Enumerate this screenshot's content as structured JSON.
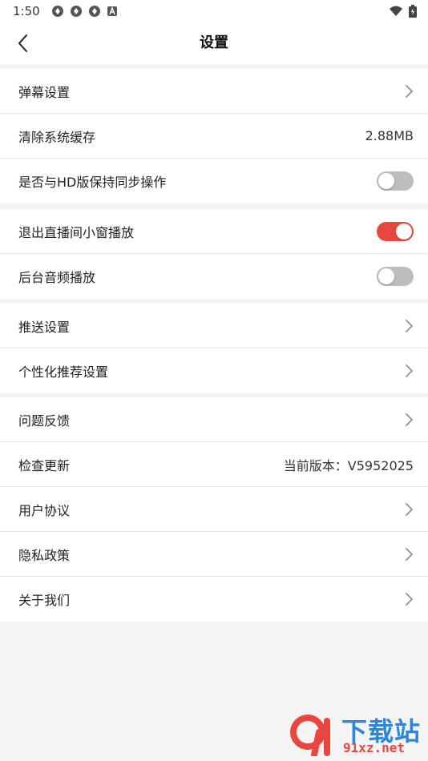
{
  "status_bar": {
    "time": "1:50",
    "notif_icons": [
      "sync-icon",
      "sync-icon",
      "sync-icon",
      "a-box-icon"
    ],
    "right_icons": [
      "wifi-icon",
      "battery-icon"
    ]
  },
  "header": {
    "title": "设置"
  },
  "groups": [
    {
      "rows": [
        {
          "label": "弹幕设置",
          "kind": "arrow"
        },
        {
          "label": "清除系统缓存",
          "kind": "value",
          "value": "2.88MB"
        },
        {
          "label": "是否与HD版保持同步操作",
          "kind": "toggle",
          "on": false
        }
      ]
    },
    {
      "rows": [
        {
          "label": "退出直播间小窗播放",
          "kind": "toggle",
          "on": true
        },
        {
          "label": "后台音频播放",
          "kind": "toggle",
          "on": false
        }
      ]
    },
    {
      "rows": [
        {
          "label": "推送设置",
          "kind": "arrow"
        },
        {
          "label": "个性化推荐设置",
          "kind": "arrow"
        }
      ]
    },
    {
      "rows": [
        {
          "label": "问题反馈",
          "kind": "arrow"
        },
        {
          "label": "检查更新",
          "kind": "value",
          "value": "当前版本：V5952025"
        },
        {
          "label": "用户协议",
          "kind": "arrow"
        },
        {
          "label": "隐私政策",
          "kind": "arrow"
        },
        {
          "label": "关于我们",
          "kind": "arrow"
        }
      ]
    }
  ],
  "watermark": {
    "logo_text": "91",
    "title": "下载站",
    "url": "91xz.net"
  },
  "colors": {
    "accent": "#e8473f",
    "toggle_off": "#bdbdbd",
    "background": "#f4f4f4",
    "watermark_blue": "#2d86d8"
  }
}
